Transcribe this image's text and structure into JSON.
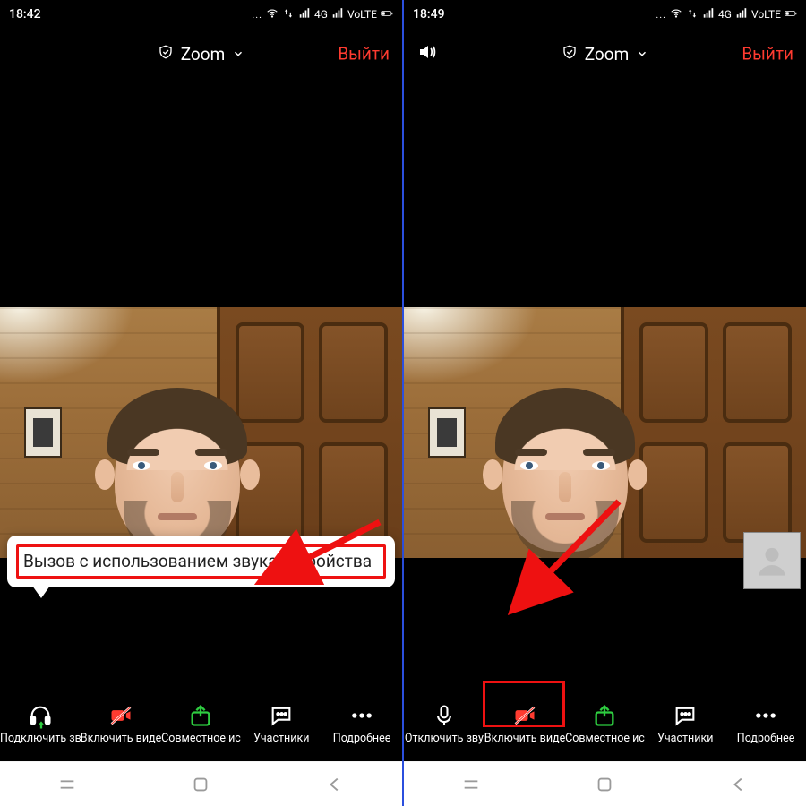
{
  "left": {
    "status": {
      "time": "18:42",
      "net1": "4G",
      "net2": "VoLTE",
      "dots": "..."
    },
    "zoom": {
      "title": "Zoom",
      "leave": "Выйти"
    },
    "tooltip": "Вызов с использованием звука устройства",
    "toolbar": {
      "audio": "Подключить зв",
      "video": "Включить виде",
      "share": "Совместное ис",
      "participants": "Участники",
      "more": "Подробнее"
    }
  },
  "right": {
    "status": {
      "time": "18:49",
      "net1": "4G",
      "net2": "VoLTE",
      "dots": "..."
    },
    "zoom": {
      "title": "Zoom",
      "leave": "Выйти"
    },
    "toolbar": {
      "audio": "Отключить зву",
      "video": "Включить виде",
      "share": "Совместное ис",
      "participants": "Участники",
      "more": "Подробнее"
    }
  }
}
